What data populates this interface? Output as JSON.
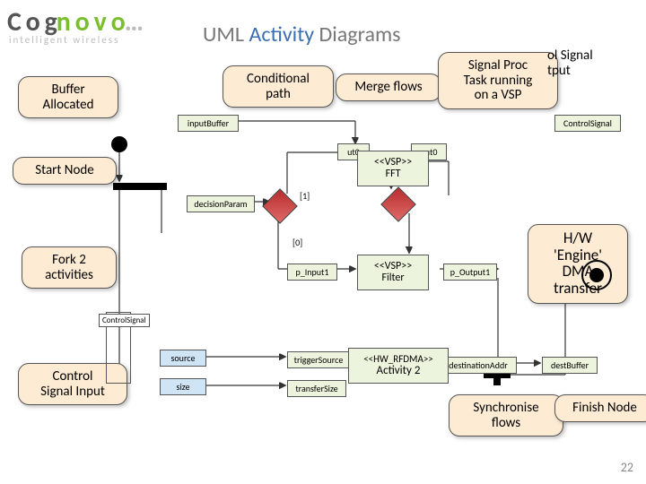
{
  "logo": {
    "spaced_tag": "C o g",
    "green": "n o v o",
    "dots": "…",
    "sub": "intelligent  wireless"
  },
  "title": {
    "pre": "UML ",
    "mid": "Activity",
    "post": " Diagrams"
  },
  "callouts": {
    "buffer_allocated": "Buffer\nAllocated",
    "conditional_path": "Conditional\npath",
    "merge_flows": "Merge flows",
    "signal_proc": "Signal Proc\nTask running\non a VSP",
    "ctrl_out_partial": "ol Signal\ntput",
    "start_node": "Start Node",
    "fork2": "Fork 2\nactivities",
    "ctrl_in": "Control\nSignal Input",
    "hw_engine": "H/W\n'Engine'\nDMA\ntransfer",
    "sync_flows": "Synchronise\nflows",
    "finish_node": "Finish Node"
  },
  "pins": {
    "input_buffer": "inputBuffer",
    "decision_param": "decisionParam",
    "p_input1": "p_Input1",
    "p_output1": "p_Output1",
    "in0": "ut0",
    "out0": "put0",
    "trigger_source": "triggerSource",
    "transfer_size": "transferSize",
    "dest_addr": "destinationAddr",
    "dest_buffer": "destBuffer",
    "control_signal": "ControlSignal"
  },
  "blue": {
    "source": "source",
    "size": "size"
  },
  "vsp": {
    "fft": {
      "stereo": "<<VSP>>",
      "name": "FFT"
    },
    "filter": {
      "stereo": "<<VSP>>",
      "name": "Filter"
    },
    "rfdma": {
      "stereo": "<<HW_RFDMA>>",
      "name": "Activity 2"
    }
  },
  "guards": {
    "one": "[1]",
    "zero": "[0]"
  },
  "frame": {
    "label": "ControlSignal"
  },
  "page": "22"
}
